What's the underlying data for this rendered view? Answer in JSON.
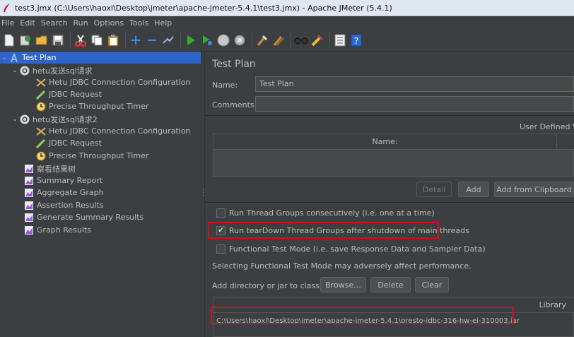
{
  "window": {
    "title": "test3.jmx (C:\\Users\\haoxi\\Desktop\\jmeter\\apache-jmeter-5.4.1\\test3.jmx) - Apache JMeter (5.4.1)"
  },
  "menu": [
    "File",
    "Edit",
    "Search",
    "Run",
    "Options",
    "Tools",
    "Help"
  ],
  "toolbar": {
    "icons": [
      "new-icon",
      "templates-icon",
      "open-icon",
      "save-icon",
      "cut-icon",
      "copy-icon",
      "paste-icon",
      "expand-icon",
      "collapse-icon",
      "toggle-icon",
      "start-icon",
      "start-no-pause-icon",
      "stop-icon",
      "shutdown-icon",
      "clear-icon",
      "clear-all-icon",
      "search-icon",
      "reset-search-icon",
      "function-helper-icon",
      "help-icon"
    ]
  },
  "tree": {
    "items": [
      {
        "label": "Test Plan",
        "icon": "test-plan-icon",
        "level": 0,
        "expanded": true,
        "selected": true
      },
      {
        "label": "hetu发送sql请求",
        "icon": "thread-group-icon",
        "level": 1,
        "expanded": true
      },
      {
        "label": "Hetu JDBC Connection Configuration",
        "icon": "config-icon",
        "level": 2
      },
      {
        "label": "JDBC Request",
        "icon": "sampler-icon",
        "level": 2
      },
      {
        "label": "Precise Throughput Timer",
        "icon": "timer-icon",
        "level": 2
      },
      {
        "label": "hetu发送sql请求2",
        "icon": "thread-group-icon",
        "level": 1,
        "expanded": true
      },
      {
        "label": "Hetu JDBC Connection Configuration",
        "icon": "config-icon",
        "level": 2
      },
      {
        "label": "JDBC Request",
        "icon": "sampler-icon",
        "level": 2
      },
      {
        "label": "Precise Throughput Timer",
        "icon": "timer-icon",
        "level": 2
      },
      {
        "label": "察看结果树",
        "icon": "listener-icon",
        "level": 1
      },
      {
        "label": "Summary Report",
        "icon": "listener-icon",
        "level": 1
      },
      {
        "label": "Aggregate Graph",
        "icon": "listener-icon",
        "level": 1
      },
      {
        "label": "Assertion Results",
        "icon": "listener-icon",
        "level": 1
      },
      {
        "label": "Generate Summary Results",
        "icon": "listener-icon",
        "level": 1
      },
      {
        "label": "Graph Results",
        "icon": "listener-icon",
        "level": 1
      }
    ]
  },
  "panel": {
    "title": "Test Plan",
    "name_label": "Name:",
    "name_value": "Test Plan",
    "comments_label": "Comments:",
    "comments_value": "",
    "udv_label": "User Defined Var",
    "udv_column": "Name:",
    "buttons": {
      "detail": "Detail",
      "add": "Add",
      "add_clipboard": "Add from Clipboard"
    },
    "options": [
      {
        "label": "Run Thread Groups consecutively (i.e. one at a time)",
        "checked": false
      },
      {
        "label": "Run tearDown Thread Groups after shutdown of main threads",
        "checked": true
      },
      {
        "label": "Functional Test Mode (i.e. save Response Data and Sampler Data)",
        "checked": false
      }
    ],
    "functional_note": "Selecting Functional Test Mode may adversely affect performance.",
    "classpath_label": "Add directory or jar to classpath",
    "classpath_buttons": {
      "browse": "Browse...",
      "delete": "Delete",
      "clear": "Clear"
    },
    "library_header": "Library",
    "library_items": [
      "C:\\Users\\haoxi\\Desktop\\jmeter\\apache-jmeter-5.4.1\\presto-jdbc-316-hw-ei-310003.jar"
    ]
  },
  "colors": {
    "background": "#3c3f41",
    "selection": "#2f65ca",
    "highlight": "#d0101a"
  }
}
